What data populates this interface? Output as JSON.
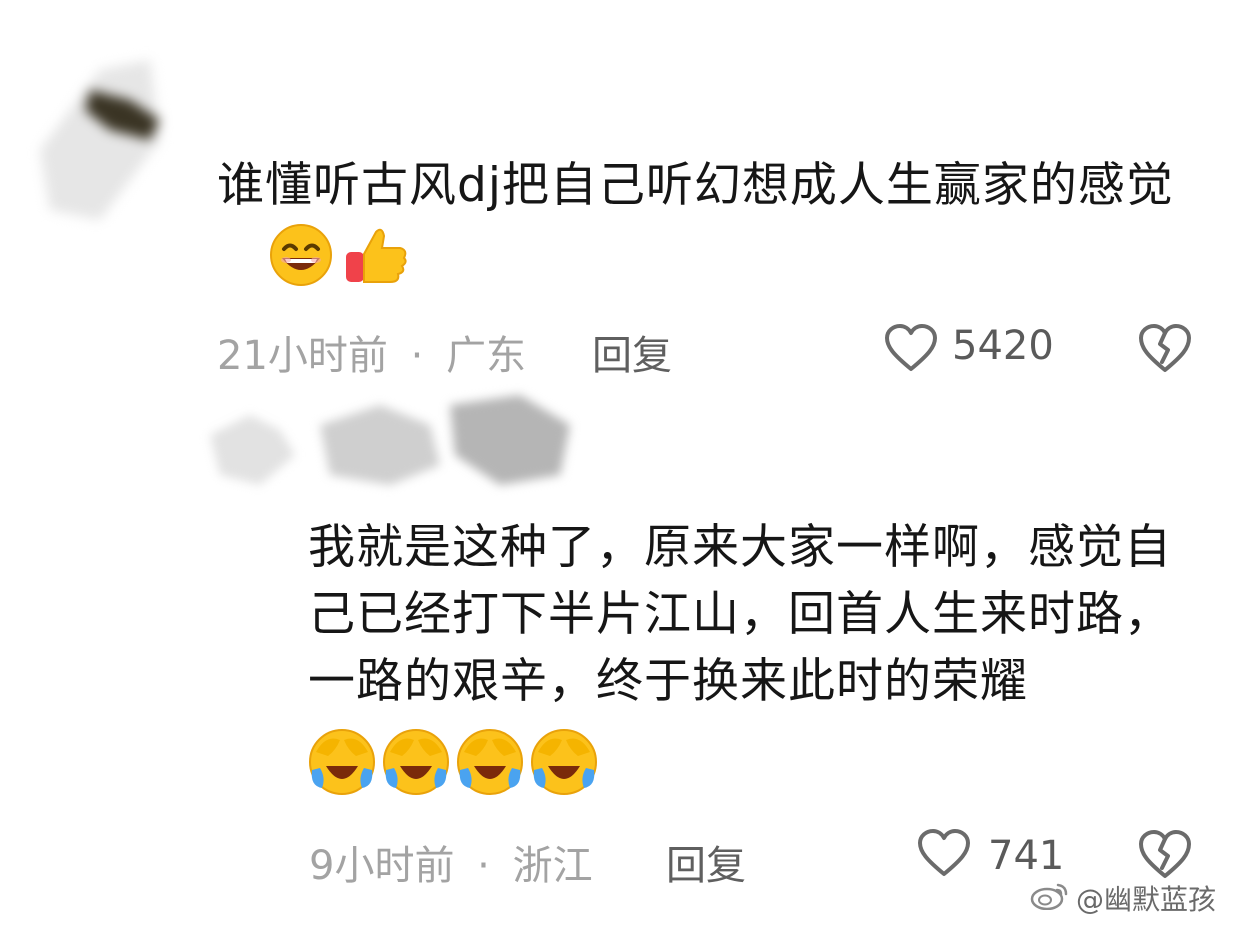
{
  "comments": [
    {
      "text": "谁懂听古风dj把自己听幻想成人生赢家的感觉",
      "emojis": [
        "grinning-face-icon",
        "thumbs-up-icon"
      ],
      "time": "21小时前",
      "separator": "·",
      "location": "广东",
      "reply_label": "回复",
      "likes": "5420"
    },
    {
      "text": "我就是这种了，原来大家一样啊，感觉自己已经打下半片江山，回首人生来时路，一路的艰辛，终于换来此时的荣耀",
      "emojis": [
        "loudly-crying-face-icon",
        "loudly-crying-face-icon",
        "loudly-crying-face-icon",
        "loudly-crying-face-icon"
      ],
      "time": "9小时前",
      "separator": "·",
      "location": "浙江",
      "reply_label": "回复",
      "likes": "741"
    }
  ],
  "watermark": {
    "text": "@幽默蓝孩",
    "icon": "weibo-logo-icon"
  },
  "colors": {
    "text": "#161616",
    "meta": "#a3a3a3",
    "reply": "#5f5f5f",
    "icon": "#6b6b6b"
  }
}
